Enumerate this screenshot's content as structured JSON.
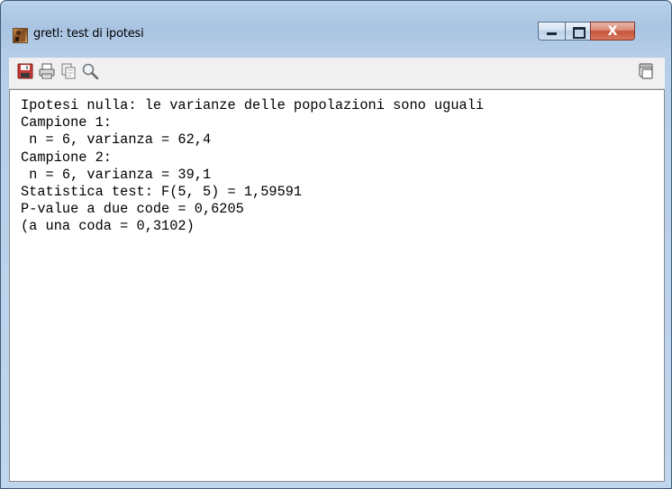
{
  "window": {
    "title": "gretl: test di ipotesi",
    "icon": "gretl-app-icon",
    "controls": {
      "minimize_icon": "minimize-icon",
      "maximize_icon": "maximize-icon",
      "close_label": "X"
    }
  },
  "toolbar": {
    "buttons": [
      {
        "icon": "save-icon"
      },
      {
        "icon": "print-icon"
      },
      {
        "icon": "copy-icon"
      },
      {
        "icon": "search-icon"
      }
    ],
    "right_button": {
      "icon": "window-icon"
    }
  },
  "output": {
    "lines": [
      "Ipotesi nulla: le varianze delle popolazioni sono uguali",
      "Campione 1:",
      " n = 6, varianza = 62,4",
      "Campione 2:",
      " n = 6, varianza = 39,1",
      "Statistica test: F(5, 5) = 1,59591",
      "P-value a due code = 0,6205",
      "(a una coda = 0,3102)"
    ]
  }
}
